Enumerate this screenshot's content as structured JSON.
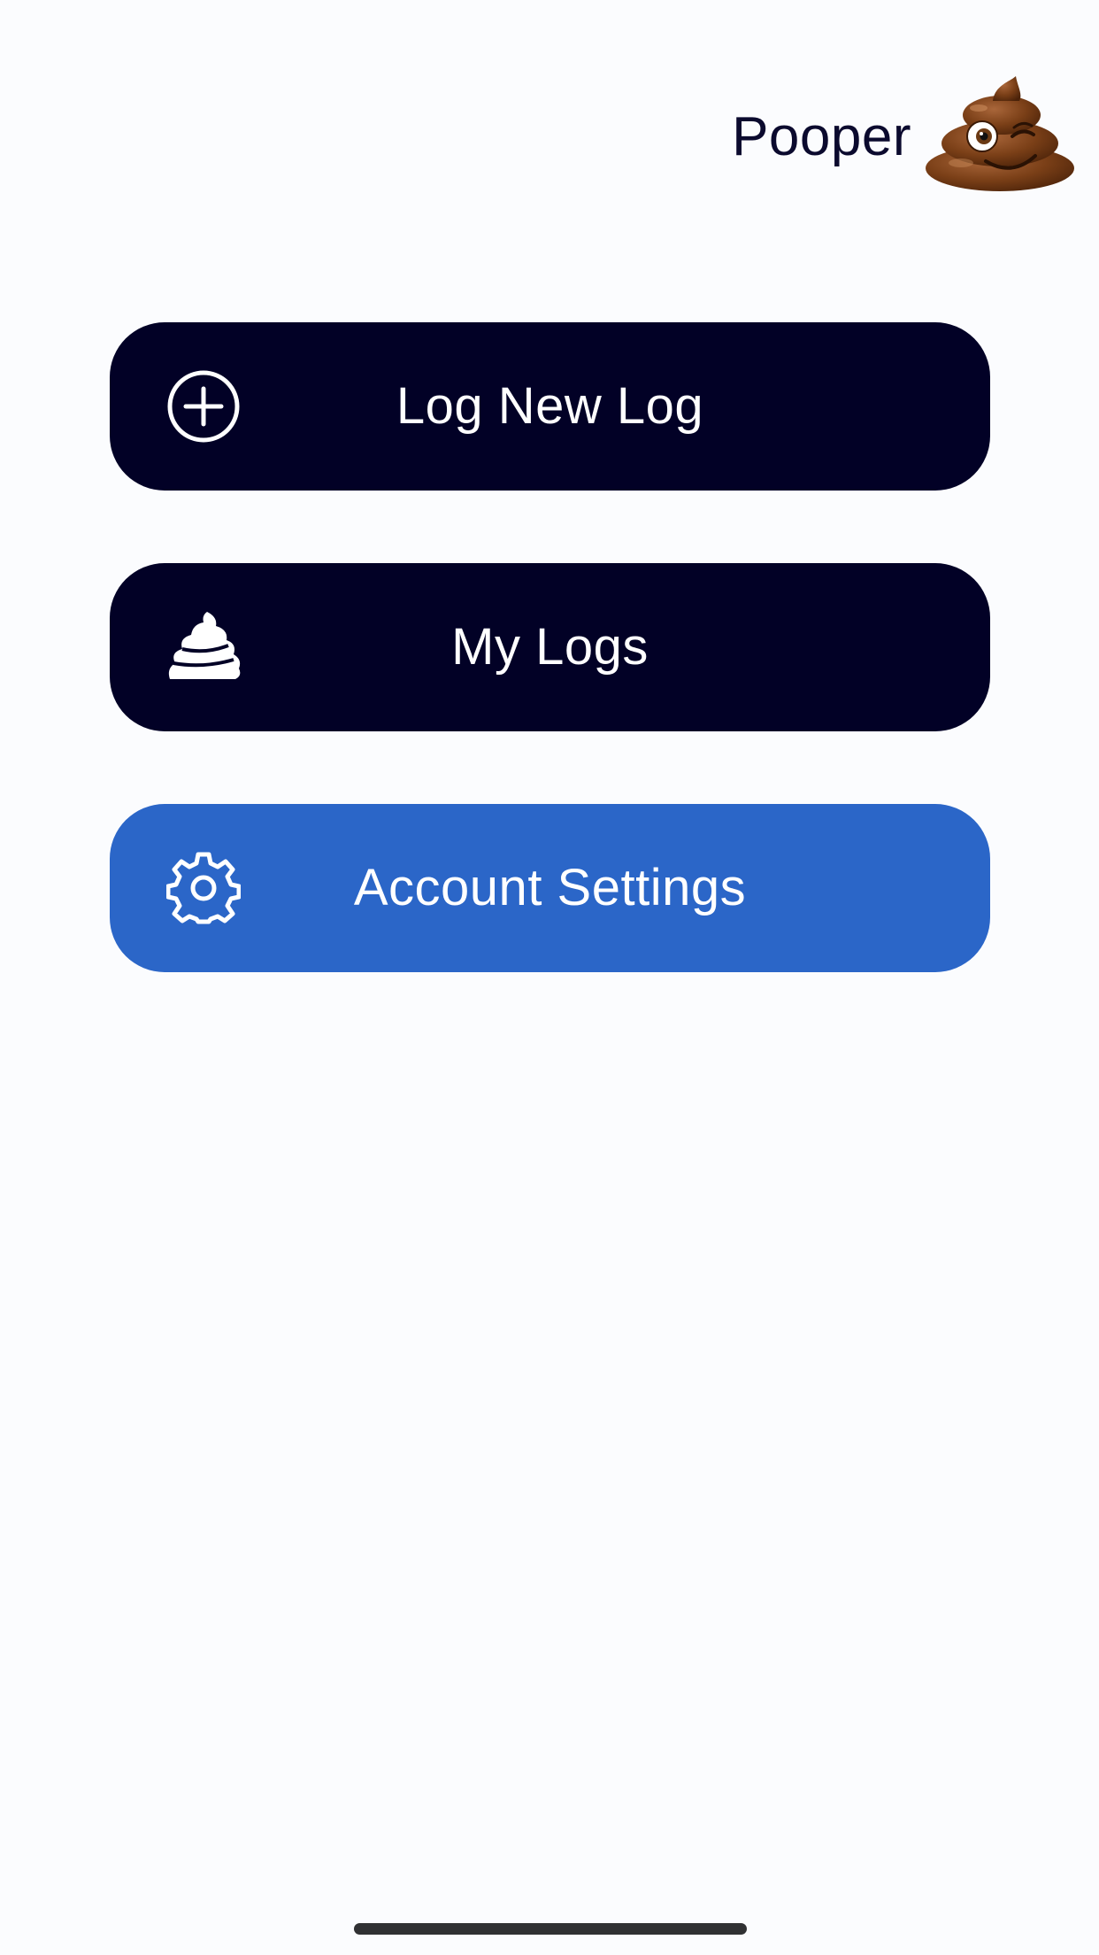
{
  "header": {
    "app_name": "Pooper",
    "mascot_icon": "winking-poop-emoji"
  },
  "menu": {
    "items": [
      {
        "label": "Log New Log",
        "icon": "plus-circle-icon",
        "color": "#020126"
      },
      {
        "label": "My Logs",
        "icon": "poop-icon",
        "color": "#020126"
      },
      {
        "label": "Account Settings",
        "icon": "gear-icon",
        "color": "#2b66c8"
      }
    ]
  },
  "colors": {
    "background": "#fbfcfe",
    "dark_button": "#020126",
    "accent_button": "#2b66c8",
    "title_text": "#0b0a2e"
  }
}
